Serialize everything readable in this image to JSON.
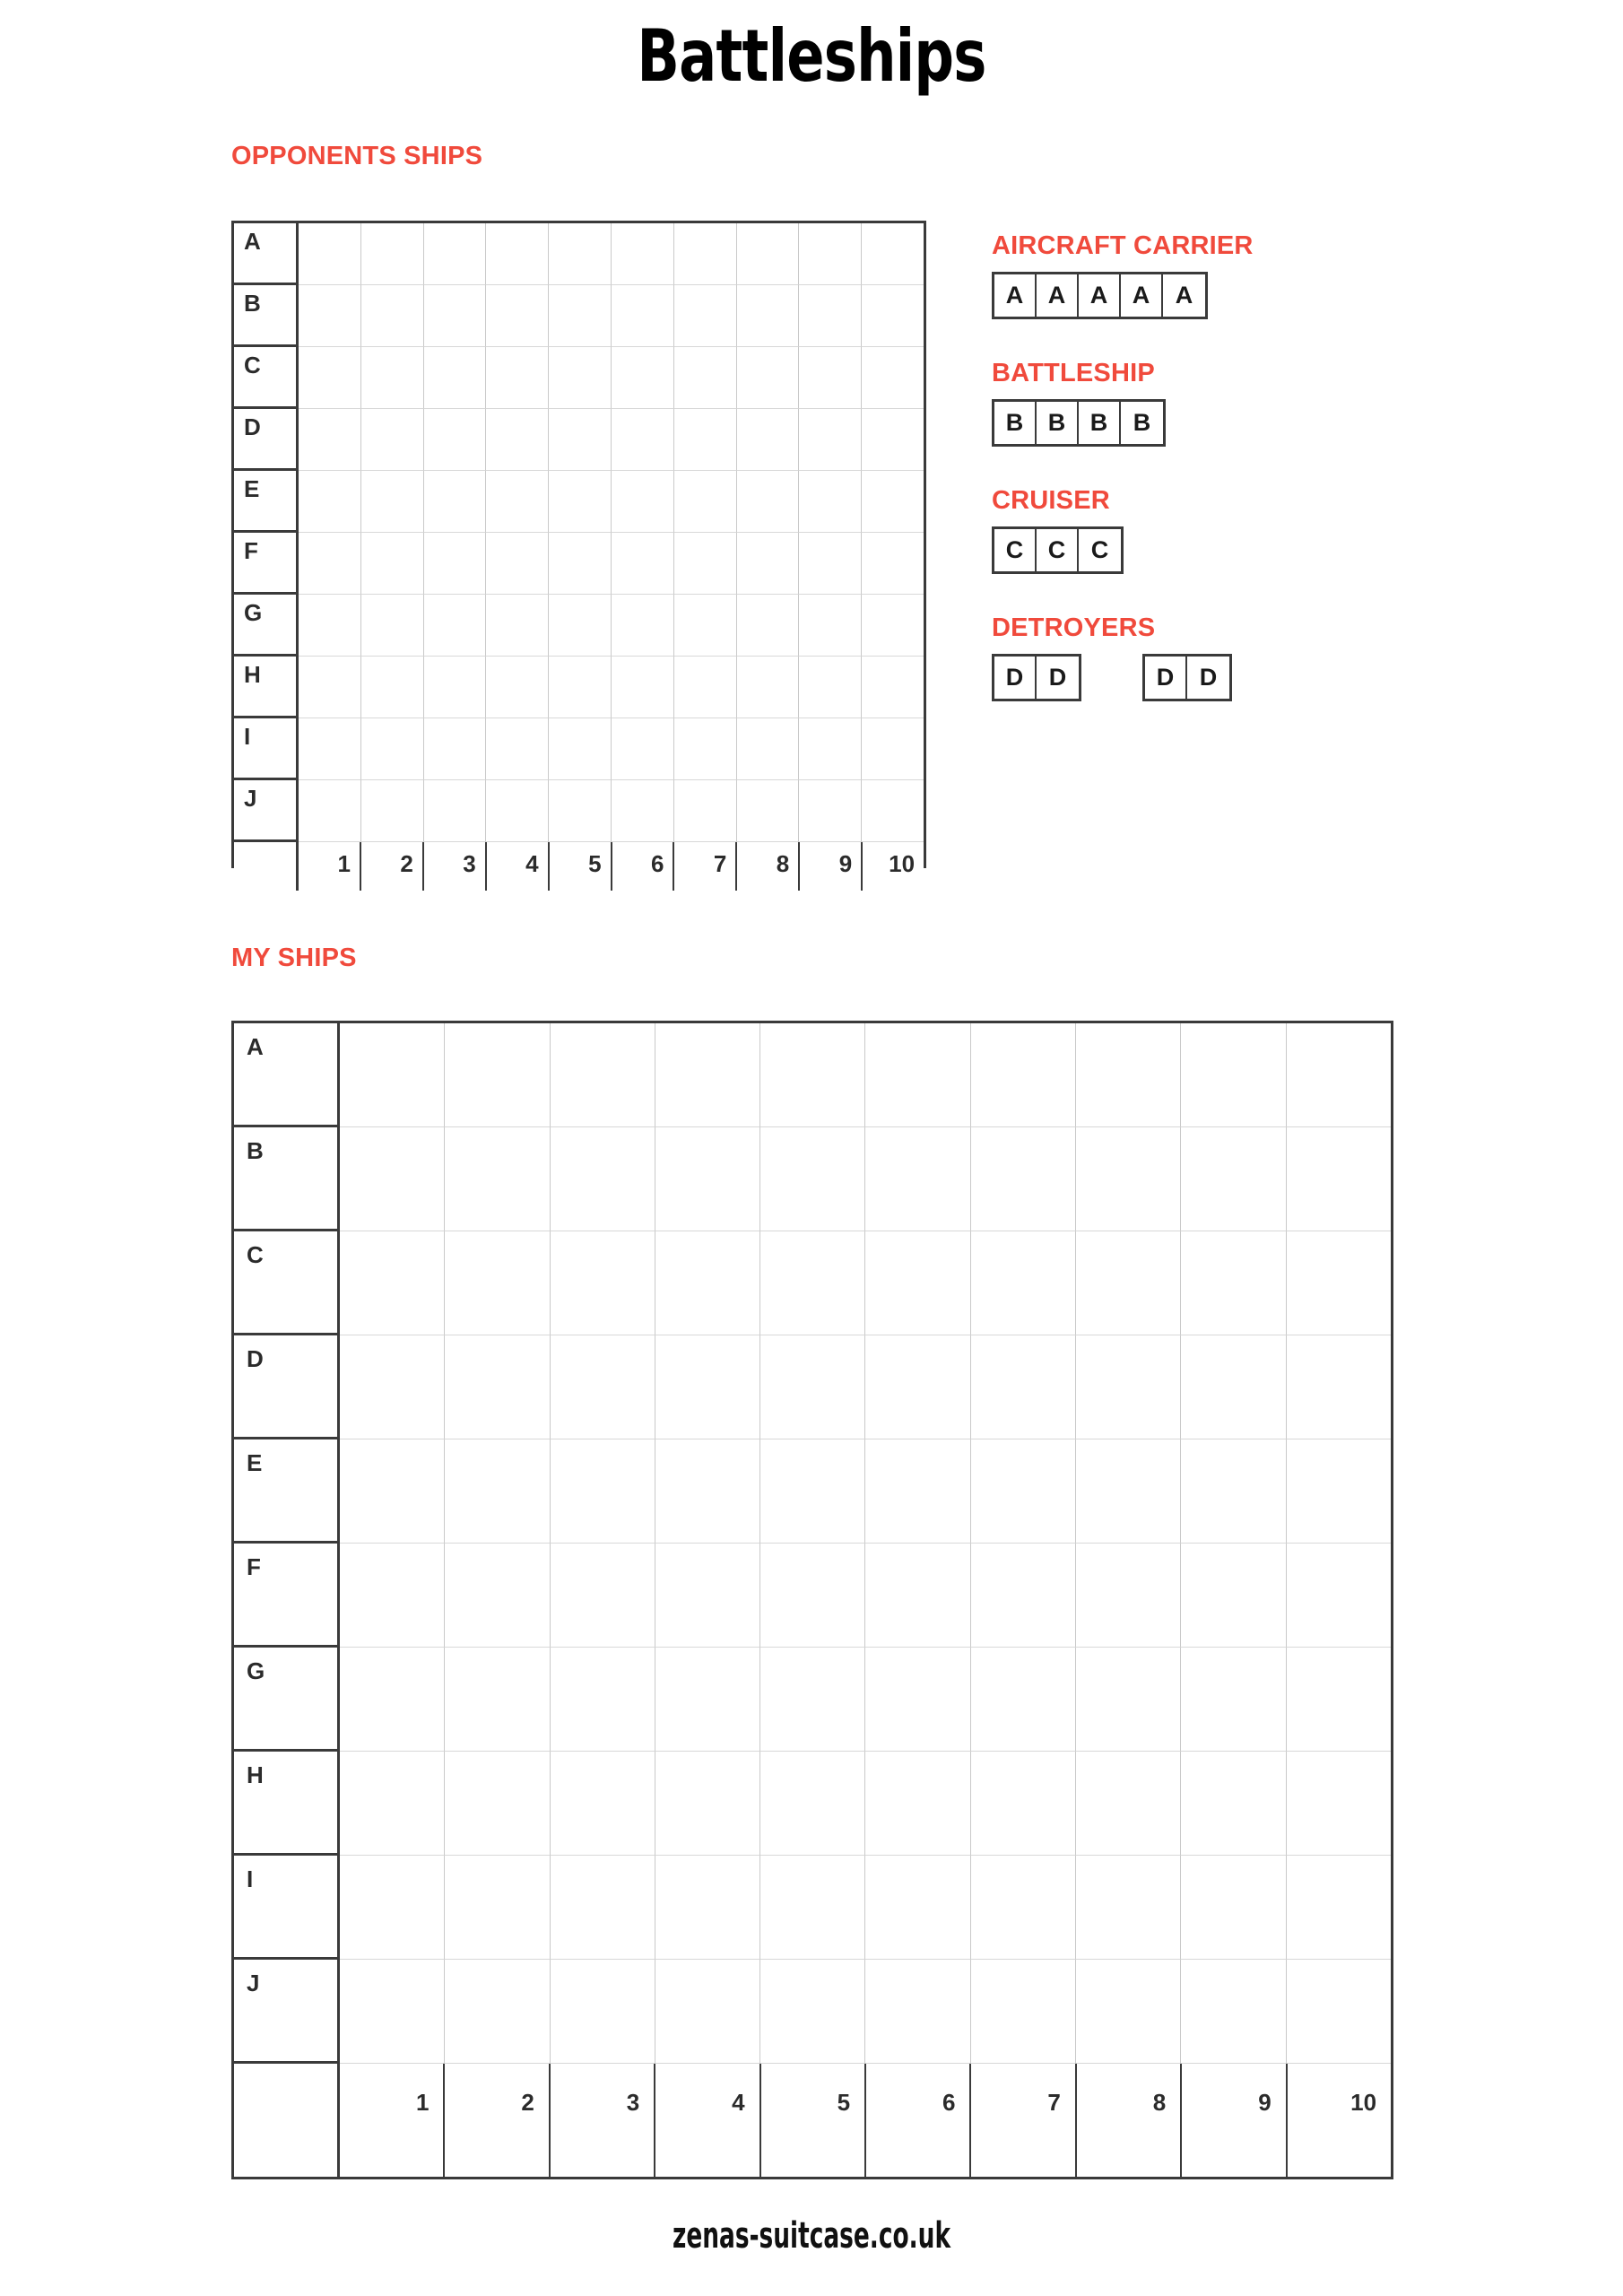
{
  "title": "Battleships",
  "sections": {
    "opponent_label": "OPPONENTS SHIPS",
    "mine_label": "MY SHIPS"
  },
  "colors": {
    "accent_red": "#f04a3c",
    "border_dark": "#3a3a3a",
    "grid_line": "#c9c9c9",
    "text": "#1a1a1a"
  },
  "boards": {
    "opponent": {
      "row_labels": [
        "A",
        "B",
        "C",
        "D",
        "E",
        "F",
        "G",
        "H",
        "I",
        "J"
      ],
      "column_labels": [
        "1",
        "2",
        "3",
        "4",
        "5",
        "6",
        "7",
        "8",
        "9",
        "10"
      ],
      "rows": 10,
      "columns": 10
    },
    "mine": {
      "row_labels": [
        "A",
        "B",
        "C",
        "D",
        "E",
        "F",
        "G",
        "H",
        "I",
        "J"
      ],
      "column_labels": [
        "1",
        "2",
        "3",
        "4",
        "5",
        "6",
        "7",
        "8",
        "9",
        "10"
      ],
      "rows": 10,
      "columns": 10
    }
  },
  "ships": [
    {
      "name": "AIRCRAFT CARRIER",
      "groups": [
        [
          "A",
          "A",
          "A",
          "A",
          "A"
        ]
      ]
    },
    {
      "name": "BATTLESHIP",
      "groups": [
        [
          "B",
          "B",
          "B",
          "B"
        ]
      ]
    },
    {
      "name": "CRUISER",
      "groups": [
        [
          "C",
          "C",
          "C"
        ]
      ]
    },
    {
      "name": "DETROYERS",
      "groups": [
        [
          "D",
          "D"
        ],
        [
          "D",
          "D"
        ]
      ]
    }
  ],
  "footer": "zenas-suitcase.co.uk"
}
